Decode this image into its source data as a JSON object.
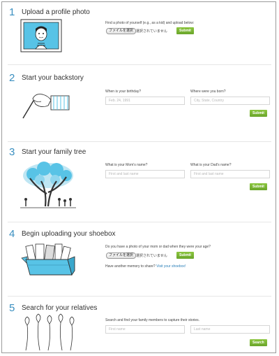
{
  "steps": [
    {
      "number": "1",
      "title": "Upload a profile photo",
      "instruction": "Find a photo of yourself (e.g., as a kid) and upload below:",
      "file_button": "ファイルを選択",
      "file_status": "選択されていません",
      "submit": "Submit"
    },
    {
      "number": "2",
      "title": "Start your backstory",
      "birthday_label": "When is your birthday?",
      "birthday_value": "Feb. 24, 1991",
      "born_label": "Where were you born?",
      "born_placeholder": "City, State, Country",
      "submit": "Submit"
    },
    {
      "number": "3",
      "title": "Start your family tree",
      "mom_label": "What is your Mom's name?",
      "mom_placeholder": "First and last name",
      "dad_label": "What is your Dad's name?",
      "dad_placeholder": "First and last name",
      "submit": "Submit"
    },
    {
      "number": "4",
      "title": "Begin uploading your shoebox",
      "question": "Do you have a photo of your mom or dad when they were your age?",
      "file_button": "ファイルを選択",
      "file_status": "選択されていません",
      "submit": "Submit",
      "another_text": "Have another memory to share?",
      "another_link": "Visit your shoebox!"
    },
    {
      "number": "5",
      "title": "Search for your relatives",
      "instruction": "Search and find your family members to capture their stories.",
      "first_placeholder": "First name",
      "last_placeholder": "Last name",
      "submit": "Search"
    }
  ],
  "colors": {
    "accent": "#3a8fc0",
    "button": "#7bb536",
    "photo_blue": "#58c3e6"
  },
  "icons": [
    "profile-portrait-icon",
    "hand-writing-icon",
    "family-tree-icon",
    "shoebox-icon",
    "balloons-icon"
  ]
}
